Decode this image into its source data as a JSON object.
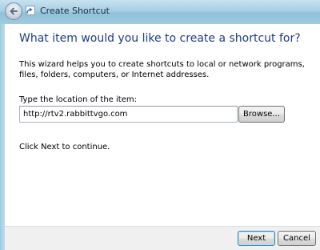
{
  "window": {
    "title": "Create Shortcut",
    "back_icon": "back-arrow-icon",
    "app_icon": "shortcut-icon"
  },
  "wizard": {
    "heading": "What item would you like to create a shortcut for?",
    "description": "This wizard helps you to create shortcuts to local or network programs, files, folders, computers, or Internet addresses.",
    "location_label": "Type the location of the item:",
    "location_value": "http://rtv2.rabbittvgo.com",
    "browse_label": "Browse...",
    "continue_text": "Click Next to continue."
  },
  "footer": {
    "next_label": "Next",
    "cancel_label": "Cancel"
  }
}
